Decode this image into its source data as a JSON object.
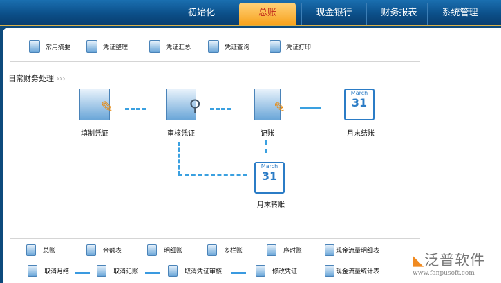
{
  "nav": {
    "tabs": [
      "初始化",
      "总账",
      "现金银行",
      "财务报表",
      "系统管理"
    ],
    "active": "总账"
  },
  "toolbar": [
    "常用摘要",
    "凭证整理",
    "凭证汇总",
    "凭证查询",
    "凭证打印"
  ],
  "section_title": "日常财务处理",
  "flow": {
    "fill": "填制凭证",
    "audit": "审核凭证",
    "post": "记账",
    "close": "月末结账",
    "transfer": "月末转账",
    "calendar_month": "March",
    "calendar_day": "31"
  },
  "bottom_row1": [
    "总账",
    "余额表",
    "明细账",
    "多栏账",
    "序时账",
    "现金流量明细表"
  ],
  "bottom_row2": [
    "取消月结",
    "取消记账",
    "取消凭证审核",
    "修改凭证",
    "现金流量统计表"
  ],
  "logo": {
    "name": "泛普软件",
    "url": "www.fanpusoft.com"
  },
  "colors": {
    "accent": "#f7a21c",
    "nav": "#0b4d86",
    "flow": "#3aa0e0"
  }
}
